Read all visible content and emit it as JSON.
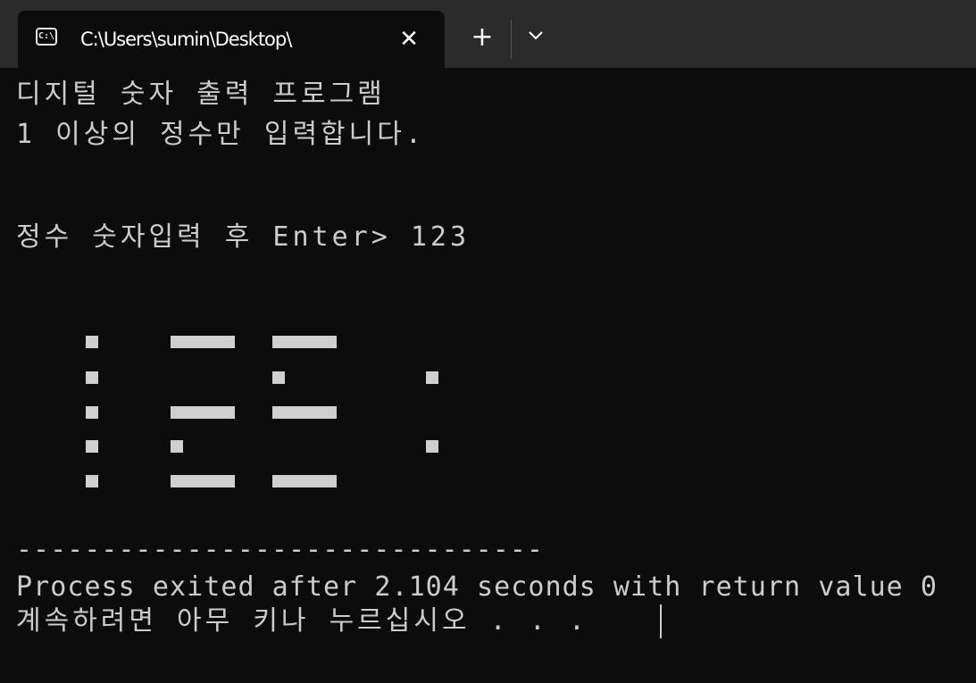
{
  "window": {
    "tab_title": "C:\\Users\\sumin\\Desktop\\",
    "tab_icon": "cmd-icon",
    "close_label": "✕",
    "new_tab_label": "+",
    "dropdown_icon": "chevron-down-icon"
  },
  "console": {
    "lines": [
      "디지털 숫자 출력 프로그램",
      "1 이상의 정수만 입력합니다.",
      "정수 숫자입력 후 Enter> 123",
      "-------------------------------",
      "Process exited after 2.104 seconds with return value 0",
      "계속하려면 아무 키나 누르십시오 . . ."
    ],
    "digital_output": "123"
  },
  "colors": {
    "background": "#0c0c0c",
    "titlebar": "#2b2b2b",
    "text": "#cccccc",
    "segment": "#cfcfcf"
  }
}
